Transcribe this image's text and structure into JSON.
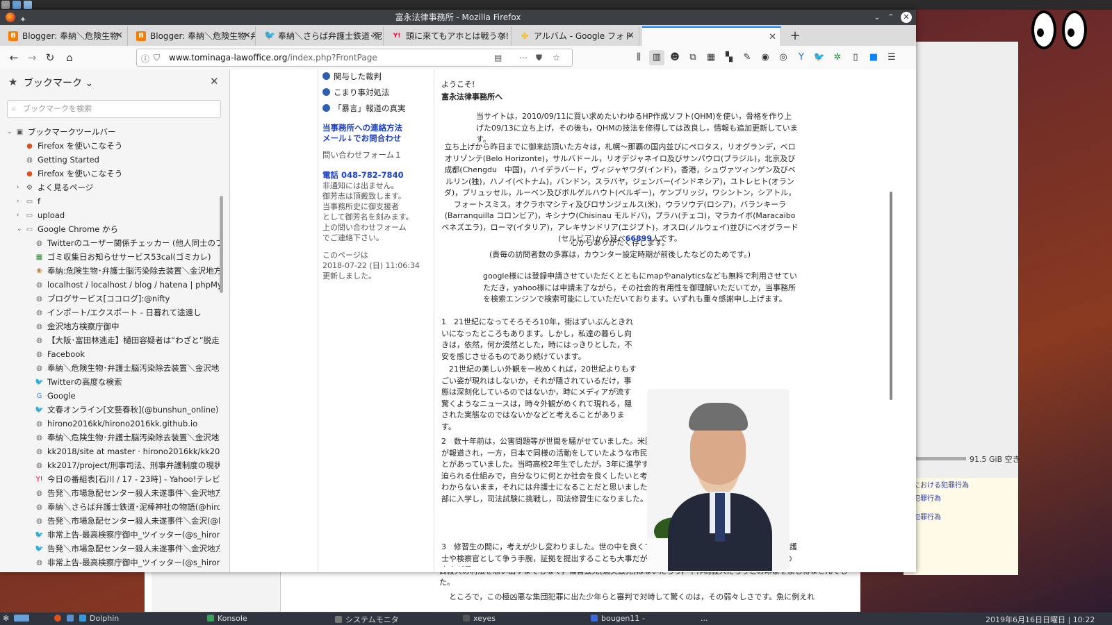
{
  "window": {
    "title": "富永法律事務所 - Mozilla Firefox"
  },
  "tabs": [
    {
      "label": "Blogger: 奉納＼危険生物･",
      "icon": "blogger-icon",
      "color": "#f57d00"
    },
    {
      "label": "Blogger: 奉納＼危険生物･弁",
      "icon": "blogger-icon",
      "color": "#f57d00"
    },
    {
      "label": "奉納＼さらば弁護士鉄道･泥",
      "icon": "twitter-icon",
      "color": "#1da1f2"
    },
    {
      "label": "頭に来てもアホとは戦うな! - Y",
      "icon": "yahoo-icon",
      "color": "#ff0033"
    },
    {
      "label": "アルバム - Google フォト",
      "icon": "google-photos-icon",
      "color": "#fbbc05"
    },
    {
      "label": "",
      "icon": "",
      "color": "#ffffff"
    }
  ],
  "navbar": {
    "url_domain": "www.tominaga-lawoffice.org",
    "url_path": "/index.php?FrontPage"
  },
  "sidebar": {
    "title": "ブックマーク ⌄",
    "search_placeholder": "ブックマークを検索",
    "items": [
      {
        "label": "ブックマークツールバー",
        "indent": 0,
        "twisty": "⌄",
        "icon": "toolbar-icon"
      },
      {
        "label": "Firefox を使いこなそう",
        "indent": 1,
        "twisty": "",
        "icon": "firefox-icon"
      },
      {
        "label": "Getting Started",
        "indent": 1,
        "twisty": "",
        "icon": "globe-icon"
      },
      {
        "label": "Firefox を使いこなそう",
        "indent": 1,
        "twisty": "",
        "icon": "firefox-icon"
      },
      {
        "label": "よく見るページ",
        "indent": 1,
        "twisty": "›",
        "icon": "gear-icon"
      },
      {
        "label": "f",
        "indent": 1,
        "twisty": "›",
        "icon": "folder-icon"
      },
      {
        "label": "upload",
        "indent": 1,
        "twisty": "›",
        "icon": "folder-icon"
      },
      {
        "label": "Google Chrome から",
        "indent": 1,
        "twisty": "⌄",
        "icon": "folder-icon"
      },
      {
        "label": "Twitterのユーザー関係チェッカー (他人同士のフォロ...",
        "indent": 2,
        "twisty": "",
        "icon": "globe-icon"
      },
      {
        "label": "ゴミ収集日お知らせサービス53cal(ゴミカレ)　ゴミの...",
        "indent": 2,
        "twisty": "",
        "icon": "calendar-icon"
      },
      {
        "label": "奉納:危険生物･弁護士脳汚染除去装置＼金沢地方検",
        "indent": 2,
        "twisty": "",
        "icon": "bookmark-icon"
      },
      {
        "label": "localhost / localhost / blog / hatena | phpMyAdmi",
        "indent": 2,
        "twisty": "",
        "icon": "globe-icon"
      },
      {
        "label": "ブログサービス[ココログ]:@nifty",
        "indent": 2,
        "twisty": "",
        "icon": "globe-icon"
      },
      {
        "label": "インポート/エクスポート - 日暮れて途遠し",
        "indent": 2,
        "twisty": "",
        "icon": "globe-icon"
      },
      {
        "label": "金沢地方検察庁御中",
        "indent": 2,
        "twisty": "",
        "icon": "globe-icon"
      },
      {
        "label": "【大阪･富田林逃走】樋田容疑者は“わざと”脱走させら...",
        "indent": 2,
        "twisty": "",
        "icon": "globe-icon"
      },
      {
        "label": "Facebook",
        "indent": 2,
        "twisty": "",
        "icon": "globe-icon"
      },
      {
        "label": "奉納＼危険生物･弁護士脳汚染除去装置＼金沢地方...",
        "indent": 2,
        "twisty": "",
        "icon": "globe-icon"
      },
      {
        "label": "Twitterの高度な検索",
        "indent": 2,
        "twisty": "",
        "icon": "twitter-icon"
      },
      {
        "label": "Google",
        "indent": 2,
        "twisty": "",
        "icon": "google-icon"
      },
      {
        "label": "文春オンライン[文藝春秋](@bunshun_online)さん | ...",
        "indent": 2,
        "twisty": "",
        "icon": "twitter-icon"
      },
      {
        "label": "hirono2016kk/hirono2016kk.github.io",
        "indent": 2,
        "twisty": "",
        "icon": "globe-icon"
      },
      {
        "label": "奉納＼危険生物･弁護士脳汚染除去装置＼金沢地方...",
        "indent": 2,
        "twisty": "",
        "icon": "globe-icon"
      },
      {
        "label": "kk2018/site at master · hirono2016kk/kk2018",
        "indent": 2,
        "twisty": "",
        "icon": "globe-icon"
      },
      {
        "label": "kk2017/project/刑事司法、刑事弁護制度の現状と問",
        "indent": 2,
        "twisty": "",
        "icon": "globe-icon"
      },
      {
        "label": "今日の番組表[石川 / 17 - 23時] - Yahoo!テレビ.Gガ...",
        "indent": 2,
        "twisty": "",
        "icon": "yahoo-icon"
      },
      {
        "label": "告発＼市場急配センター殺人未遂事件＼金沢地方検...",
        "indent": 2,
        "twisty": "",
        "icon": "globe-icon"
      },
      {
        "label": "奉納＼さらば弁護士鉄道･泥棒神社の物語(@hirono_...",
        "indent": 2,
        "twisty": "",
        "icon": "globe-icon"
      },
      {
        "label": "告発＼市場急配センター殺人未遂事件＼金沢(@kk_h",
        "indent": 2,
        "twisty": "",
        "icon": "globe-icon"
      },
      {
        "label": "非常上告-最高検察庁御中_ツイッター(@s_hirono)さ...",
        "indent": 2,
        "twisty": "",
        "icon": "twitter-icon"
      },
      {
        "label": "告発＼市場急配センター殺人未遂事件＼金沢地方検...",
        "indent": 2,
        "twisty": "",
        "icon": "twitter-icon"
      },
      {
        "label": "非常上告-最高検察庁御中_ツイッター(@s_hirono) - T...",
        "indent": 2,
        "twisty": "",
        "icon": "globe-icon"
      }
    ]
  },
  "page": {
    "nav_links": [
      "関与した裁判",
      "こまり事対処法",
      "「暴言」報道の真実"
    ],
    "contact_heading_1": "当事務所への連絡方法",
    "contact_heading_2": "メール↓でお問合わせ",
    "contact_form": "問い合わせフォーム１",
    "phone": "電話 048-782-7840",
    "phone_notes": [
      "非通知には出ません。",
      "御芳志は頂戴致します。",
      "当事務所史に御支援者",
      "として御芳名を刻みます。",
      "上の問い合わせフォーム",
      "でご連絡下さい。"
    ],
    "updated_1": "このページは",
    "updated_2": "2018-07-22 (日) 11:06:34",
    "updated_3": "更新しました。",
    "welcome": "ようこそ!",
    "office_to": "富永法律事務所へ",
    "intro": "当サイトは，2010/09/11に買い求めたいわゆるHP作成ソフト(QHM)を使い，骨格を作り上げた09/13に立ち上げ，その後も，QHMの技法を修得しては改良し，情報も追加更新しています。",
    "visitors_p1": "立ち上げから昨日までに御来訪頂いた方々は，札幌～那覇の国内並びにペロタス，リオグランデ，ベロオリゾンテ(Belo Horizonte)，サルバドール，リオデジャネイロ及びサンパウロ(ブラジル)，北京及び成都(Chengdu　中国)，ハイデラバード，ヴィジャヤワダ(インド)，香港，シュヴァツィンゲン及びベルリン(独)，ハノイ(ベトナム)，バンドン，スラバヤ，ジェンバー(インドネシア)，ユトレヒト(オランダ)，ブリュッセル，ルーベン及びボルゲルハウト(ベルギー)，ケンブリッジ，ワシントン，シアトル，フォートスミス，オクラホマシティ及びロサンジェルス(米)，ウラソウデ(ロシア)，バランキーラ(Barranquilla コロンビア)，キシナウ(Chisinau モルドバ)，プラハ(チェコ)，マラカイボ(Maracaibo ベネズエラ)，ローマ(イタリア)，アレキサンドリア(エジプト)，オスロ(ノルウェイ)並びにベオグラード(セルビア)から延べ",
    "visitor_count": "66899",
    "visitors_suffix": "人です。",
    "thanks": "心からありがたく存じます。",
    "note": "(貴毎の訪問者数の多寡は，カウンター設定時期が前後したなどのためです。)",
    "google_p": "google様には登録申請させていただくとともにmapやanalyticsなども無料で利用させていただき，yahoo様には申請未了ながら，その社会的有用性を御理解いただいてか，当事務所を検索エンジンで検索可能にしていただいております。いずれも重々感謝申し上げます。",
    "sec1": "1　21世紀になってそろそろ10年，街はずいぶんときれいになったところもあります。しかし，私達の暮らし向きは，依然，何か漠然とした，時にはっきりとした，不安を感じさせるものであり続けています。",
    "sec1b": "　21世紀の美しい外観を一枚めくれば，20世紀よりもすごい姿が現れはしないか，それが隠されているだけ，事態は深刻化しているのではないか，時にメディアが流す驚くようなニュースは，時々外観がめくれて現れる，隠された実態なのではないかなどと考えることがあります。",
    "sec2": "2　数十年前は，公害問題等が世間を騒がせていました。米国のラルフネーダー弁護士の活動が報道され，一方，日本で同様の活動をしていたような市民運動家が恐喝罪で逮捕などのことがあっていました。当時高校2年生でしたが，3年に進学する際に，文科系理科系の選択を迫られる仕組みで，自分なりに何とか社会を良くしたいと考え，実際，何ができるかはよくわからないまま，それには弁護士になることだと思いました。文科系を選び，一橋大学法学部に入学し，司法試験に挑戦し，司法修習生になりました。",
    "sec3": "3　修習生の間に，考えが少し変わりました。世の中を良くするには良い裁判が必要だ，それには，弁護士や検察官として争う手腕，証拠を提出することも大事だが，正しい判断をすることができる裁判官の存在が最"
  },
  "desktop": {
    "disk_free": "91.5 GiB 空き",
    "note_lines": [
      "ーにおける犯罪行為",
      "る犯罪行為",
      "る犯罪行為"
    ],
    "low_text_1": "高殺人の利法を思い出すまでもなく，傷害致死(過失致死)はないだろう，不作為殺人だろうとの印象を禁じ得ませんでした。",
    "low_text_2": "ところで，この極凶悪な集団犯罪に出た少年らと審判で対峙して驚くのは，その弱々しさです。魚に例えれ"
  },
  "taskbar": {
    "items": [
      "Dolphin",
      "Konsole",
      "システムモニタ",
      "xeyes",
      "bougen11 -",
      "..."
    ],
    "clock": "2019年6月16日日曜日 | 10:22"
  }
}
